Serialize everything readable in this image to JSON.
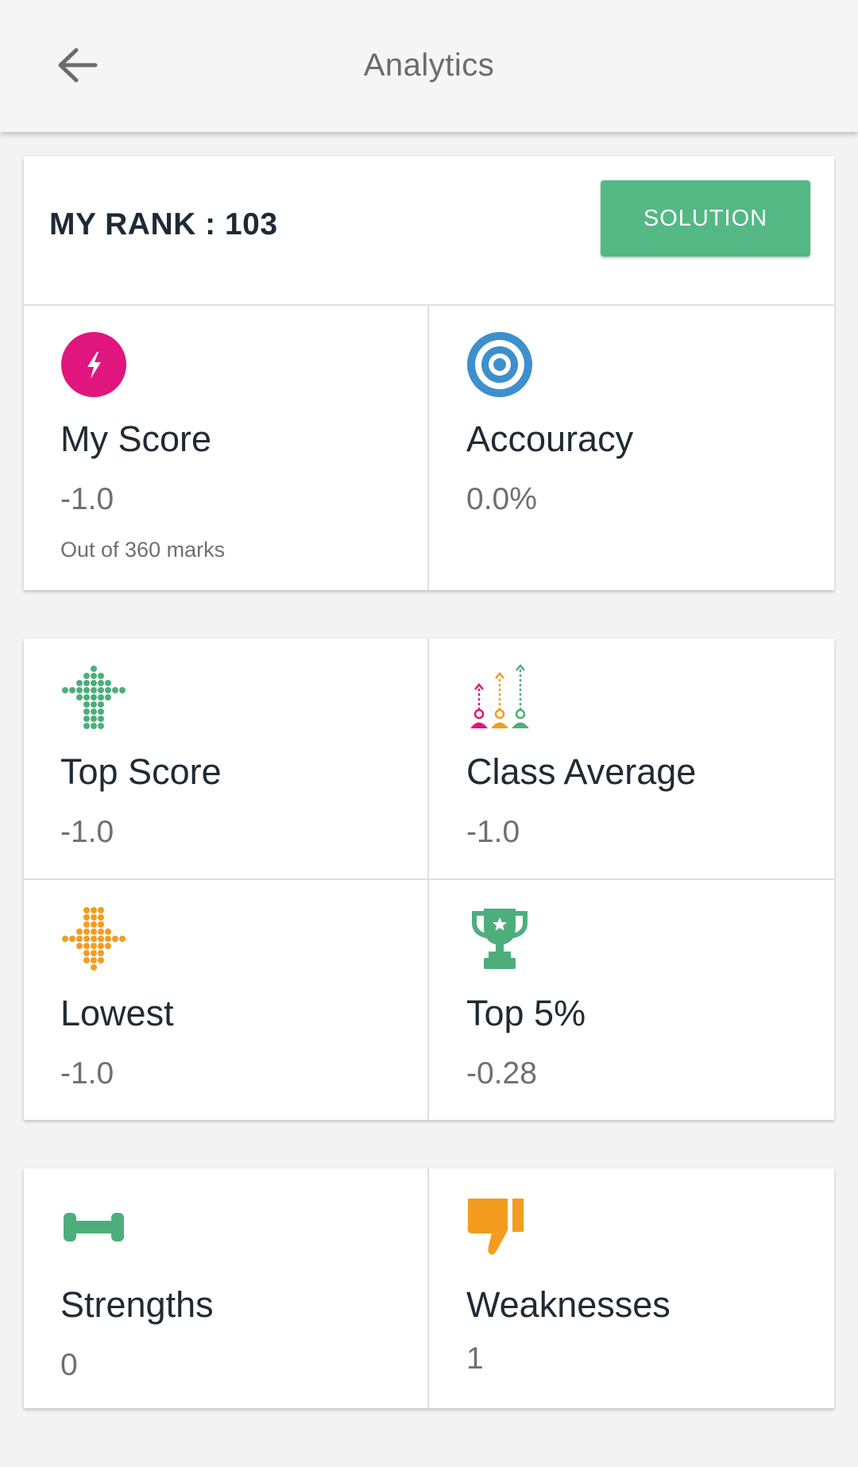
{
  "header": {
    "title": "Analytics",
    "back_icon": "arrow-left-icon"
  },
  "rank": {
    "text": "MY RANK : 103",
    "solution_label": "SOLUTION",
    "solution_color": "#54b884"
  },
  "stats": {
    "my_score": {
      "label": "My Score",
      "value": "-1.0",
      "sub": "Out of 360 marks",
      "icon": "lightning-icon",
      "color": "#e0157d"
    },
    "accuracy": {
      "label": "Accouracy",
      "value": "0.0%",
      "icon": "target-icon",
      "color": "#3d8fce"
    },
    "top_score": {
      "label": "Top Score",
      "value": "-1.0",
      "icon": "dotted-arrow-up-icon",
      "color": "#4dae7c"
    },
    "class_average": {
      "label": "Class Average",
      "value": "-1.0",
      "icon": "class-average-icon"
    },
    "lowest": {
      "label": "Lowest",
      "value": "-1.0",
      "icon": "dotted-arrow-down-icon",
      "color": "#f39c1f"
    },
    "top_5": {
      "label": "Top 5%",
      "value": "-0.28",
      "icon": "trophy-icon",
      "color": "#4dae7c"
    }
  },
  "performance": {
    "strengths": {
      "label": "Strengths",
      "value": "0",
      "icon": "dumbbell-icon",
      "color": "#4dae7c"
    },
    "weaknesses": {
      "label": "Weaknesses",
      "value": "1",
      "icon": "thumbs-down-icon",
      "color": "#f39c1f"
    }
  }
}
